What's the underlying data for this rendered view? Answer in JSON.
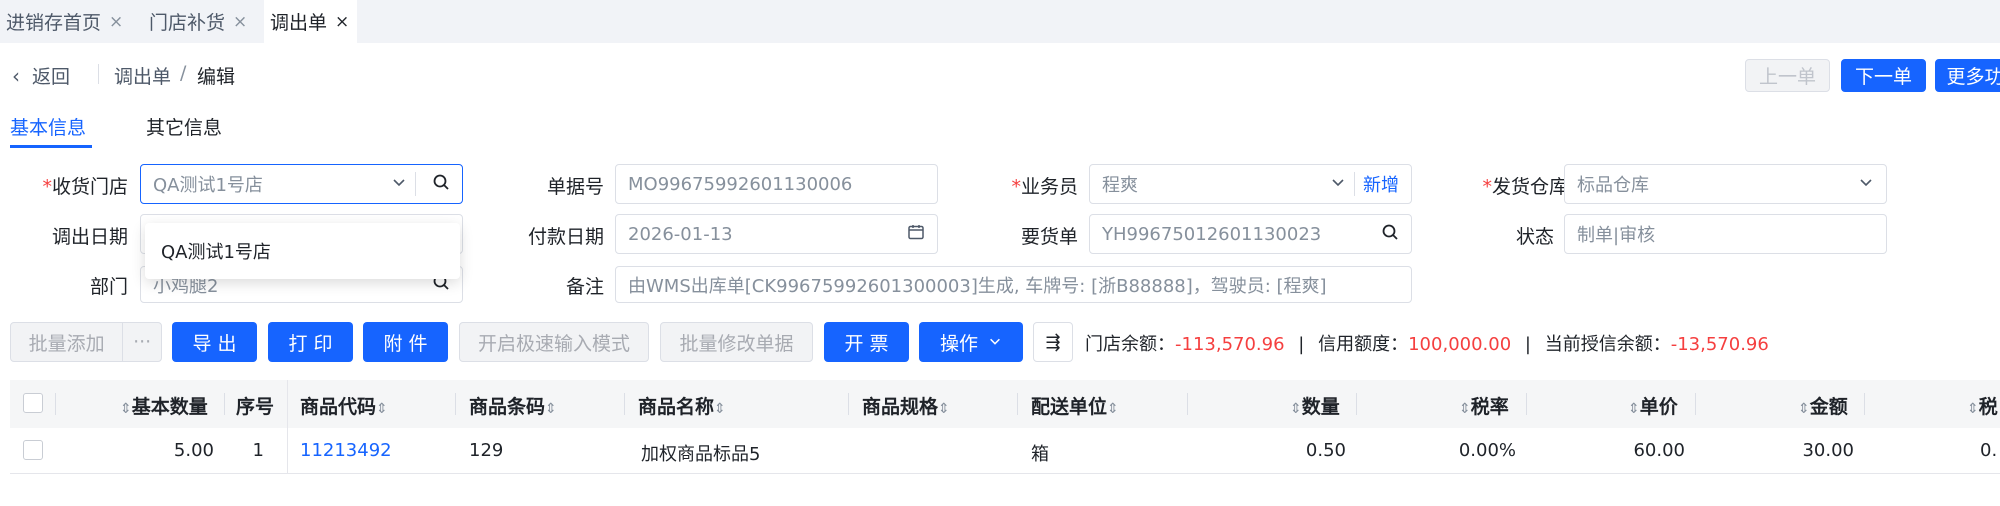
{
  "tabs": [
    {
      "label": "进销存首页",
      "close": "×"
    },
    {
      "label": "门店补货",
      "close": "×"
    },
    {
      "label": "调出单",
      "close": "×"
    }
  ],
  "header": {
    "back_label": "返回",
    "breadcrumb_parent": "调出单",
    "breadcrumb_sep": "/",
    "breadcrumb_current": "编辑",
    "prev_label": "上一单",
    "next_label": "下一单",
    "more_label": "更多功"
  },
  "section_tabs": [
    "基本信息",
    "其它信息"
  ],
  "form": {
    "receive_store": {
      "label": "收货门店",
      "value": "QA测试1号店"
    },
    "doc_no": {
      "label": "单据号",
      "value": "MO99675992601130006"
    },
    "salesman": {
      "label": "业务员",
      "value": "程爽",
      "add_label": "新增"
    },
    "warehouse": {
      "label": "发货仓库",
      "value": "标品仓库"
    },
    "out_date": {
      "label": "调出日期",
      "value": ""
    },
    "pay_date": {
      "label": "付款日期",
      "value": "2026-01-13"
    },
    "request_no": {
      "label": "要货单",
      "value": "YH99675012601130023"
    },
    "status": {
      "label": "状态",
      "value": "制单|审核"
    },
    "department": {
      "label": "部门",
      "value": "小鸡腿2"
    },
    "remark": {
      "label": "备注",
      "value": "由WMS出库单[CK99675992601300003]生成, 车牌号: [浙B88888]，驾驶员: [程爽]"
    }
  },
  "dropdown_option": "QA测试1号店",
  "toolbar": {
    "batch_add": "批量添加",
    "more_dots": "···",
    "export": "导 出",
    "print": "打 印",
    "attach": "附 件",
    "fast_input": "开启极速输入模式",
    "batch_edit": "批量修改单据",
    "invoice": "开 票",
    "operate": "操作",
    "column_setting": "⇶"
  },
  "balance": {
    "store_label": "门店余额：",
    "store_value": "-113,570.96",
    "sep1": "|",
    "credit_label": "信用额度：",
    "credit_value": "100,000.00",
    "sep2": "|",
    "current_label": "当前授信余额：",
    "current_value": "-13,570.96"
  },
  "table": {
    "columns": [
      "基本数量",
      "序号",
      "商品代码",
      "商品条码",
      "商品名称",
      "商品规格",
      "配送单位",
      "数量",
      "税率",
      "单价",
      "金额",
      "税"
    ],
    "rows": [
      {
        "base_qty": "5.00",
        "seq": "1",
        "code": "11213492",
        "barcode": "129",
        "name": "加权商品标品5",
        "spec": "",
        "unit": "箱",
        "qty": "0.50",
        "tax": "0.00%",
        "price": "60.00",
        "amount": "30.00",
        "tax2": "0."
      }
    ]
  },
  "colors": {
    "primary": "#1664ff",
    "danger": "#f53f3f",
    "border": "#dcdfe6"
  }
}
